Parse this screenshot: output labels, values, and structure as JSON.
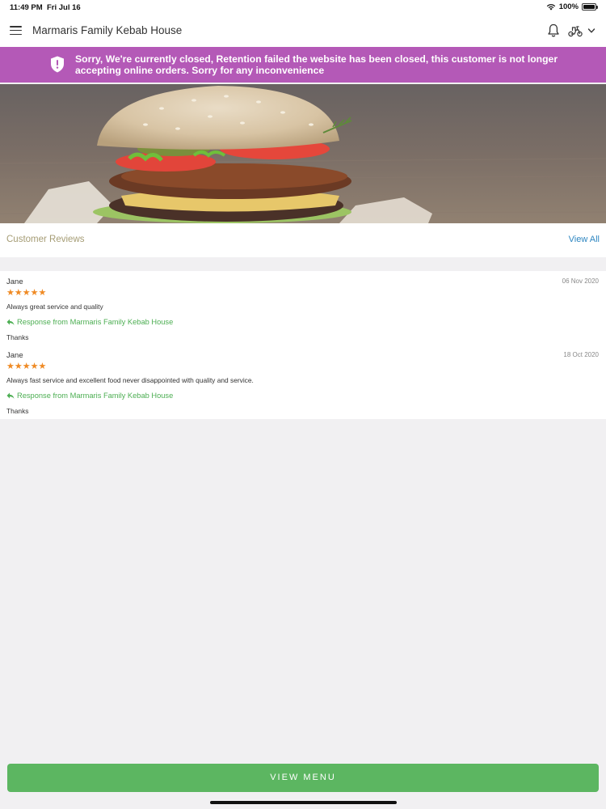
{
  "status_bar": {
    "time": "11:49 PM",
    "date": "Fri Jul 16",
    "battery": "100%"
  },
  "header": {
    "title": "Marmaris Family Kebab House",
    "icons": [
      "menu-icon",
      "bell-icon",
      "scooter-icon",
      "chevron-down-icon"
    ]
  },
  "banner": {
    "message": "Sorry, We're currently closed, Retention failed the website has been closed, this customer is not longer accepting online orders. Sorry for any inconvenience",
    "color": "#b459b7",
    "icon": "shield-alert-icon"
  },
  "reviews": {
    "title": "Customer Reviews",
    "view_all_label": "View All",
    "items": [
      {
        "name": "Jane",
        "date": "06 Nov 2020",
        "rating": 5,
        "stars": "★★★★★",
        "text": "Always great service and quality",
        "response_label": "Response from Marmaris Family Kebab House",
        "response_text": "Thanks"
      },
      {
        "name": "Jane",
        "date": "18 Oct 2020",
        "rating": 5,
        "stars": "★★★★★",
        "text": "Always fast service and excellent food never disappointed with quality and service.",
        "response_label": "Response from Marmaris Family Kebab House",
        "response_text": "Thanks"
      }
    ]
  },
  "footer": {
    "view_menu_label": "VIEW MENU",
    "button_color": "#5cb661"
  },
  "colors": {
    "star": "#ef8a24",
    "response": "#4cae52",
    "link": "#2e86c1"
  }
}
